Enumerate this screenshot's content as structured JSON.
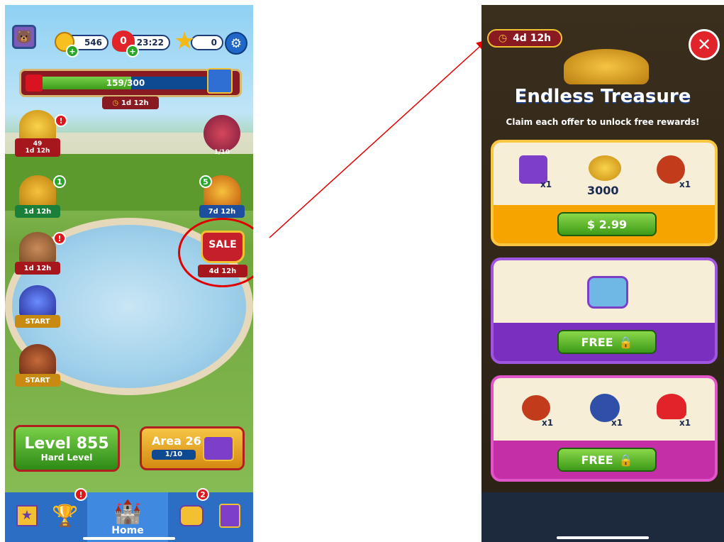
{
  "left_screen": {
    "hud": {
      "coins": "546",
      "lives": "0",
      "lives_timer": "23:22",
      "stars": "0",
      "progress_text": "159/300",
      "progress_fraction": 0.53,
      "progress_timer": "1d 12h"
    },
    "events_left": [
      {
        "count": "49",
        "timer": "1d 12h"
      },
      {
        "timer": "1d 12h",
        "badge": "1"
      },
      {
        "timer": "1d 12h"
      },
      {
        "label": "START"
      },
      {
        "label": "START"
      }
    ],
    "events_right": [
      {
        "progress": "1/10"
      },
      {
        "badge": "5",
        "timer": "7d 12h"
      },
      {
        "title": "SALE",
        "timer": "4d 12h"
      }
    ],
    "level_button": {
      "title": "Level 855",
      "subtitle": "Hard Level"
    },
    "area_button": {
      "title": "Area 26",
      "progress": "1/10"
    },
    "nav": {
      "home_label": "Home",
      "team_badge": "2"
    }
  },
  "right_screen": {
    "timer": "4d 12h",
    "title": "Endless Treasure",
    "subtitle": "Claim each offer to unlock free rewards!",
    "offers": [
      {
        "items": [
          {
            "icon": "hammer-icon",
            "qty": "x1"
          },
          {
            "icon": "coins-icon",
            "qty": "3000"
          },
          {
            "icon": "tnt-icon",
            "qty": "x1"
          }
        ],
        "button": "$ 2.99",
        "color": "#f5a400"
      },
      {
        "items": [
          {
            "icon": "chest-icon",
            "qty": ""
          }
        ],
        "button": "FREE",
        "color": "#7a2fbf"
      },
      {
        "items": [
          {
            "icon": "crossbow-icon",
            "qty": "x1"
          },
          {
            "icon": "cannon-icon",
            "qty": "x1"
          },
          {
            "icon": "jester-hat-icon",
            "qty": "x1"
          }
        ],
        "button": "FREE",
        "color": "#c42ea6"
      }
    ]
  },
  "colors": {
    "annotation": "#e00000"
  }
}
